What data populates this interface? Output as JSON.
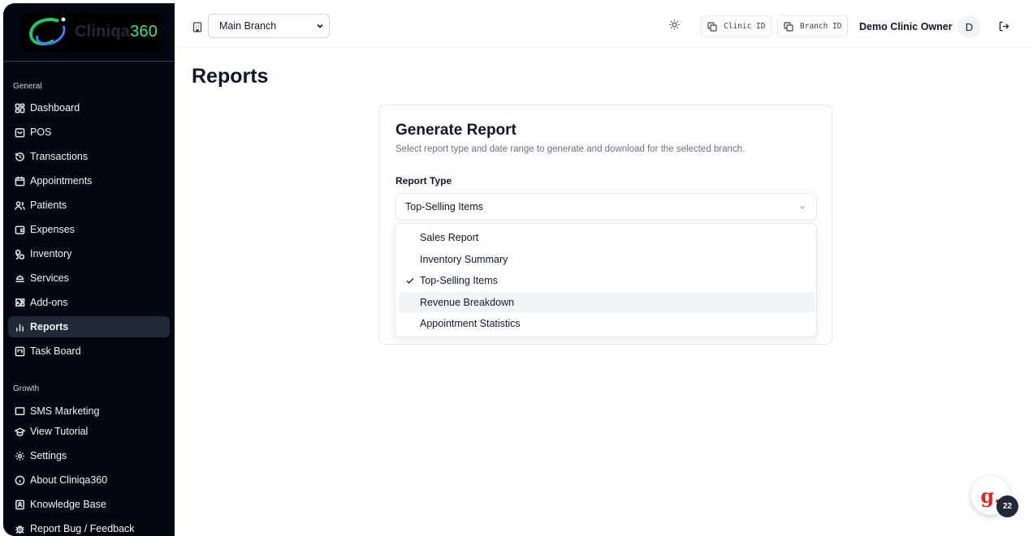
{
  "app": {
    "logo_text": "Cliniqa",
    "logo_number": "360"
  },
  "sidebar": {
    "section_general": "General",
    "general_items": [
      {
        "label": "Dashboard",
        "icon": "dashboard-icon"
      },
      {
        "label": "POS",
        "icon": "pos-icon"
      },
      {
        "label": "Transactions",
        "icon": "history-icon"
      },
      {
        "label": "Appointments",
        "icon": "calendar-icon"
      },
      {
        "label": "Patients",
        "icon": "users-icon"
      },
      {
        "label": "Expenses",
        "icon": "wallet-icon"
      },
      {
        "label": "Inventory",
        "icon": "boxes-icon"
      },
      {
        "label": "Services",
        "icon": "services-icon"
      },
      {
        "label": "Add-ons",
        "icon": "puzzle-icon"
      },
      {
        "label": "Reports",
        "icon": "chart-icon",
        "active": true
      },
      {
        "label": "Task Board",
        "icon": "kanban-icon"
      }
    ],
    "section_growth": "Growth",
    "growth_items": [
      {
        "label": "SMS Marketing",
        "icon": "message-icon"
      }
    ],
    "bottom_items": [
      {
        "label": "View Tutorial",
        "icon": "graduation-icon"
      },
      {
        "label": "Settings",
        "icon": "gear-icon"
      },
      {
        "label": "About Cliniqa360",
        "icon": "info-icon"
      },
      {
        "label": "Knowledge Base",
        "icon": "book-icon"
      },
      {
        "label": "Report Bug / Feedback",
        "icon": "bug-icon"
      }
    ]
  },
  "topbar": {
    "branch_selected": "Main Branch",
    "clinic_id_label": "Clinic ID",
    "branch_id_label": "Branch ID",
    "user_name": "Demo Clinic Owner",
    "avatar_initial": "D"
  },
  "main": {
    "page_title": "Reports",
    "card": {
      "title": "Generate Report",
      "description": "Select report type and date range to generate and download for the selected branch.",
      "report_type_label": "Report Type",
      "report_type_value": "Top-Selling Items",
      "options": [
        {
          "label": "Sales Report",
          "selected": false,
          "hover": false
        },
        {
          "label": "Inventory Summary",
          "selected": false,
          "hover": false
        },
        {
          "label": "Top-Selling Items",
          "selected": true,
          "hover": false
        },
        {
          "label": "Revenue Breakdown",
          "selected": false,
          "hover": true
        },
        {
          "label": "Appointment Statistics",
          "selected": false,
          "hover": false
        }
      ]
    }
  },
  "widget": {
    "logo": "g.",
    "badge_count": "22"
  },
  "colors": {
    "sidebar_bg": "#030712",
    "active_item_bg": "#1f2937",
    "accent_green": "#4ade80",
    "widget_red": "#dc2626"
  }
}
